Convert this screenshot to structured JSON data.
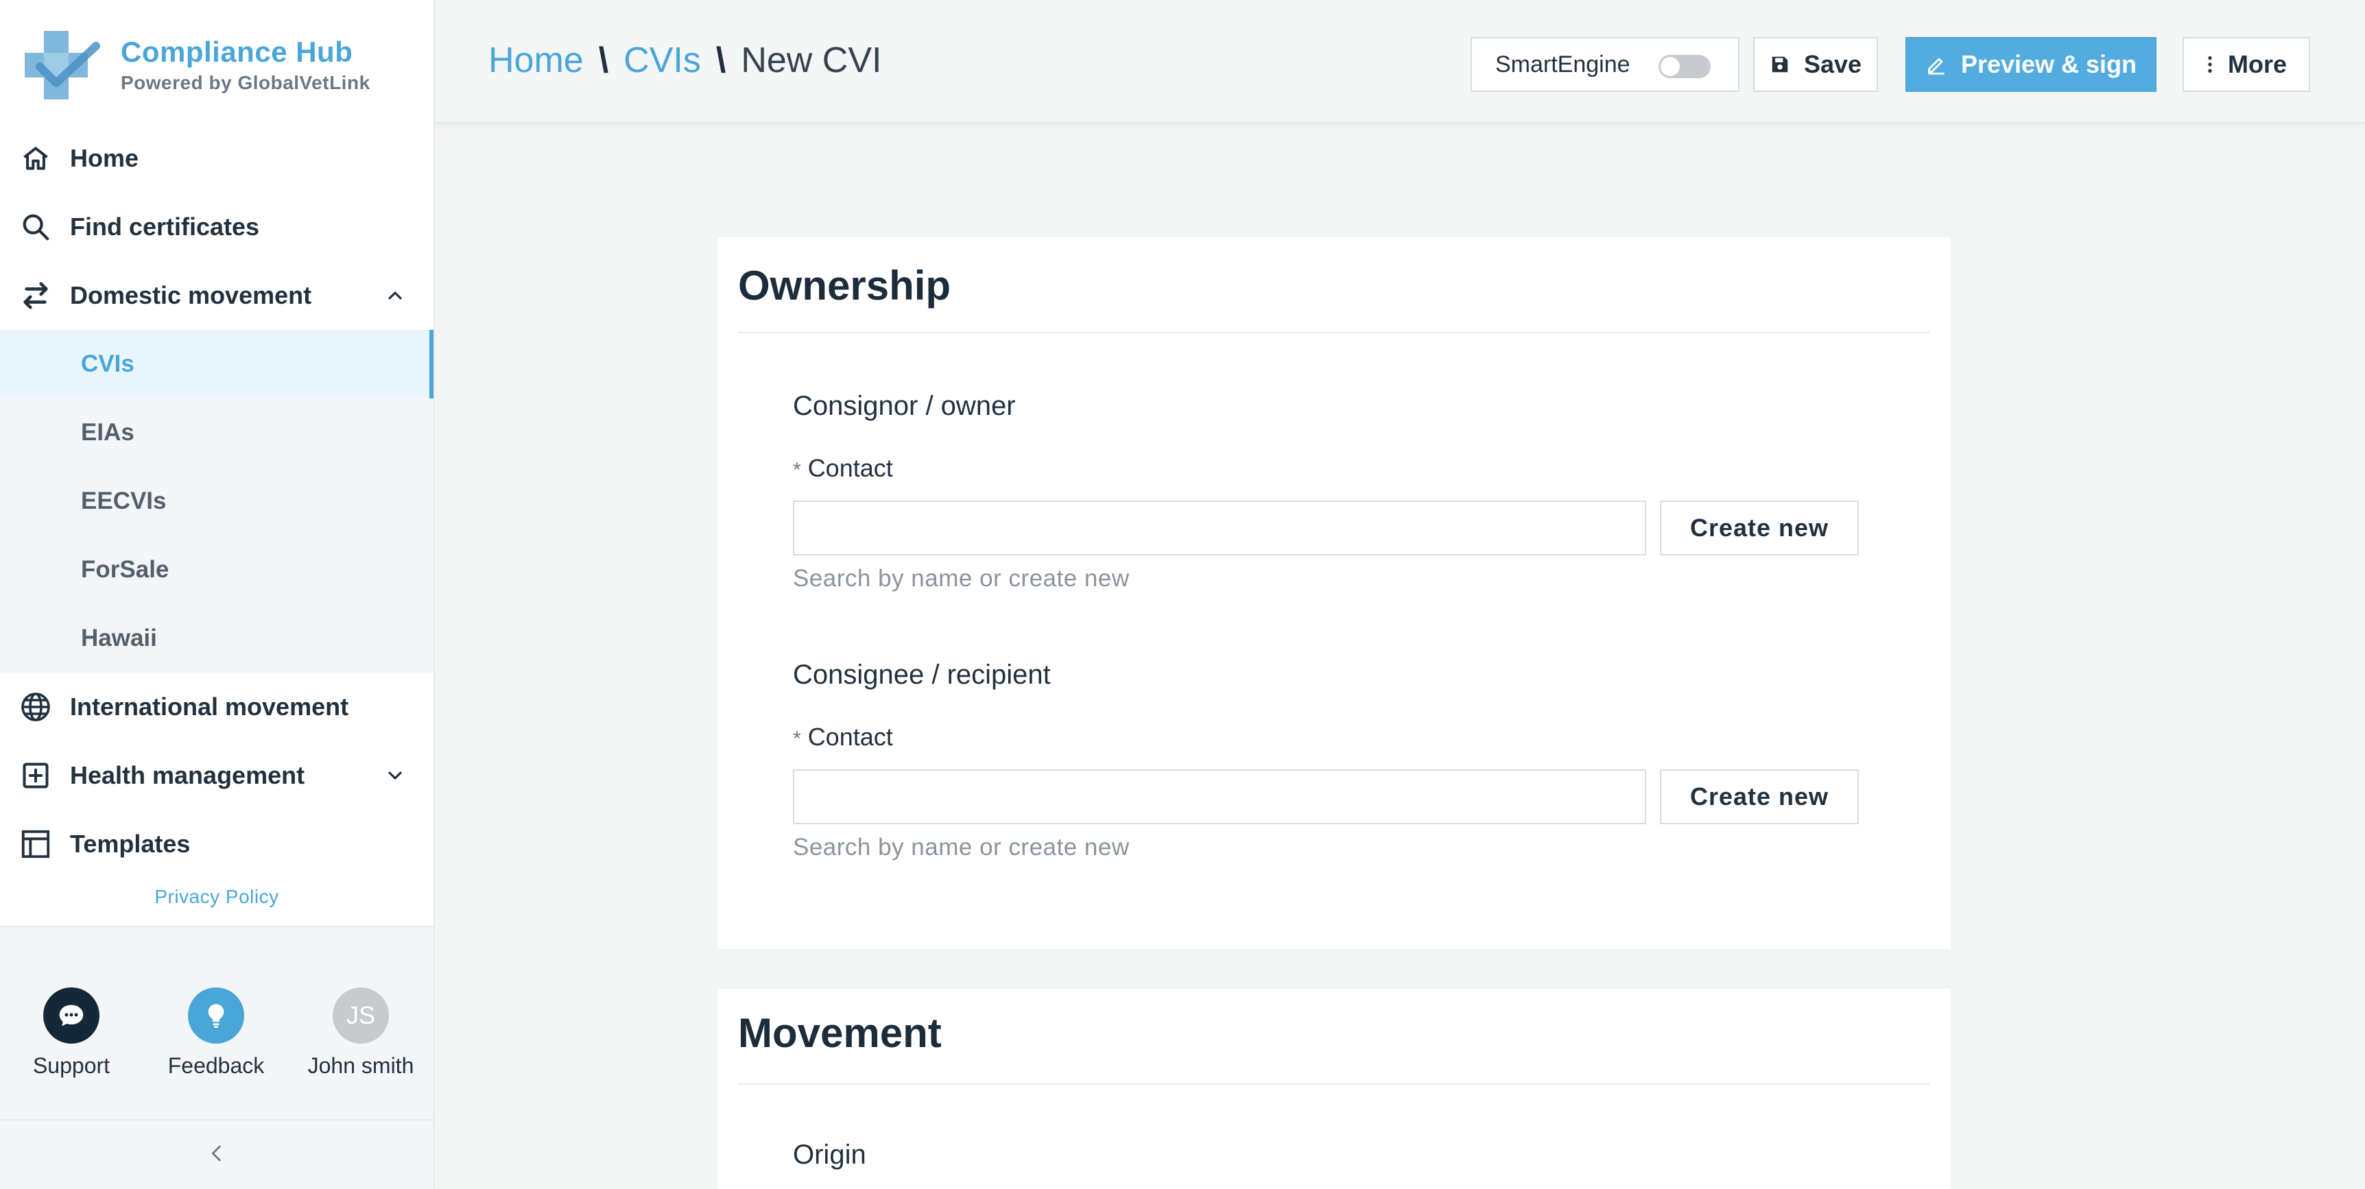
{
  "brand": {
    "title": "Compliance Hub",
    "subtitle": "Powered by GlobalVetLink"
  },
  "nav": {
    "home": "Home",
    "find_certificates": "Find certificates",
    "domestic_movement": "Domestic movement",
    "domestic_sub": [
      "CVIs",
      "EIAs",
      "EECVIs",
      "ForSale",
      "Hawaii"
    ],
    "international_movement": "International movement",
    "health_management": "Health management",
    "templates": "Templates"
  },
  "privacy": "Privacy Policy",
  "footer": {
    "support": "Support",
    "feedback": "Feedback",
    "user_initials": "JS",
    "user_name": "John smith"
  },
  "breadcrumb": {
    "home": "Home",
    "cvis": "CVIs",
    "current": "New CVI",
    "separator": "\\"
  },
  "toolbar": {
    "smart_engine": "SmartEngine",
    "smart_engine_on": false,
    "save": "Save",
    "preview_sign": "Preview & sign",
    "more": "More"
  },
  "ownership": {
    "title": "Ownership",
    "consignor": {
      "title": "Consignor / owner",
      "label": "Contact",
      "required": "*",
      "value": "",
      "create": "Create new",
      "hint": "Search by name or create new"
    },
    "consignee": {
      "title": "Consignee / recipient",
      "label": "Contact",
      "required": "*",
      "value": "",
      "create": "Create new",
      "hint": "Search by name or create new"
    }
  },
  "movement": {
    "title": "Movement",
    "origin": "Origin"
  },
  "colors": {
    "accent": "#4aa6d8",
    "text": "#22313f",
    "muted": "#8a949e"
  }
}
